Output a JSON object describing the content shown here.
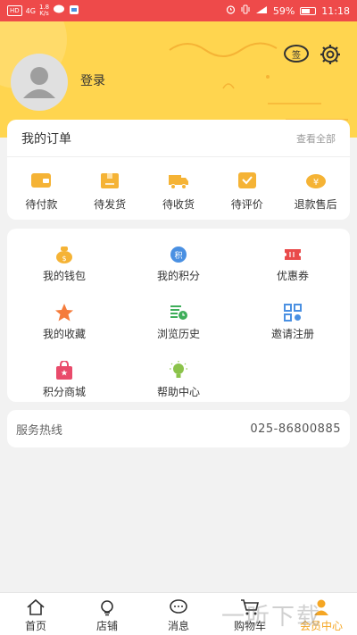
{
  "status_bar": {
    "carrier_chip": "HD",
    "network": "4G",
    "speed_value": "1.8",
    "speed_unit": "K/s",
    "battery": "59%",
    "time": "11:18"
  },
  "profile": {
    "login_label": "登录",
    "sign_in_label": "签"
  },
  "orders": {
    "title": "我的订单",
    "view_all": "查看全部",
    "items": [
      {
        "label": "待付款",
        "icon": "wallet-icon"
      },
      {
        "label": "待发货",
        "icon": "package-icon"
      },
      {
        "label": "待收货",
        "icon": "truck-icon"
      },
      {
        "label": "待评价",
        "icon": "review-icon"
      },
      {
        "label": "退款售后",
        "icon": "refund-icon"
      }
    ]
  },
  "services": {
    "items": [
      {
        "label": "我的钱包",
        "icon": "money-bag-icon"
      },
      {
        "label": "我的积分",
        "icon": "points-icon",
        "glyph": "积"
      },
      {
        "label": "优惠券",
        "icon": "coupon-icon"
      },
      {
        "label": "我的收藏",
        "icon": "star-icon"
      },
      {
        "label": "浏览历史",
        "icon": "history-icon"
      },
      {
        "label": "邀请注册",
        "icon": "qr-icon"
      },
      {
        "label": "积分商城",
        "icon": "shop-bag-icon"
      },
      {
        "label": "帮助中心",
        "icon": "lightbulb-icon"
      }
    ]
  },
  "hotline": {
    "label": "服务热线",
    "number": "025-86800885"
  },
  "nav": {
    "items": [
      {
        "label": "首页",
        "icon": "home-icon"
      },
      {
        "label": "店铺",
        "icon": "store-icon"
      },
      {
        "label": "消息",
        "icon": "message-icon"
      },
      {
        "label": "购物车",
        "icon": "cart-icon"
      },
      {
        "label": "会员中心",
        "icon": "member-icon"
      }
    ]
  },
  "colors": {
    "status_bar": "#ee4a4a",
    "header": "#ffd54f",
    "accent": "#f5a623"
  },
  "watermark": "一听下载"
}
